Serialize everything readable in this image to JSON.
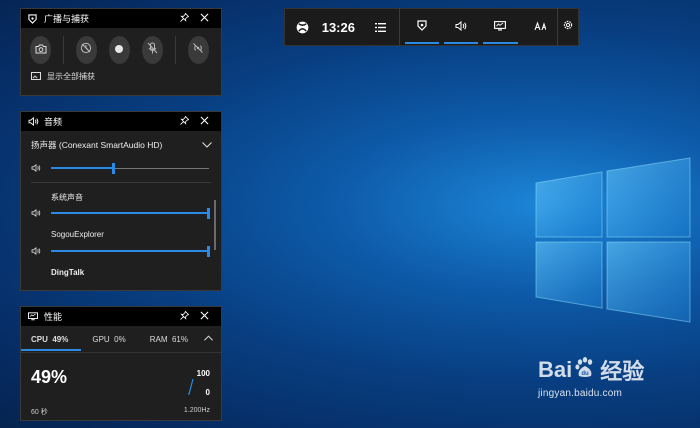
{
  "game_bar": {
    "time": "13:26"
  },
  "broadcast": {
    "title": "广播与捕获",
    "show_all": "显示全部捕获"
  },
  "audio": {
    "title": "音频",
    "device": "扬声器 (Conexant SmartAudio HD)",
    "master_volume": 0.4,
    "apps": [
      {
        "name": "系统声音",
        "volume": 1.0
      },
      {
        "name": "SogouExplorer",
        "volume": 1.0
      },
      {
        "name": "DingTalk"
      }
    ]
  },
  "performance": {
    "title": "性能",
    "tabs": [
      {
        "label": "CPU",
        "value": "49%"
      },
      {
        "label": "GPU",
        "value": "0%"
      },
      {
        "label": "RAM",
        "value": "61%"
      }
    ],
    "big_value": "49%",
    "scale_max": "100",
    "scale_min": "0",
    "window": "60 秒",
    "freq": "1.200Hz"
  },
  "watermark": {
    "brand_left": "Bai",
    "brand_right": "经验",
    "url": "jingyan.baidu.com"
  },
  "colors": {
    "accent": "#2b8ae6",
    "panel_bg": "#1f1f1f",
    "header_bg": "#000000"
  }
}
